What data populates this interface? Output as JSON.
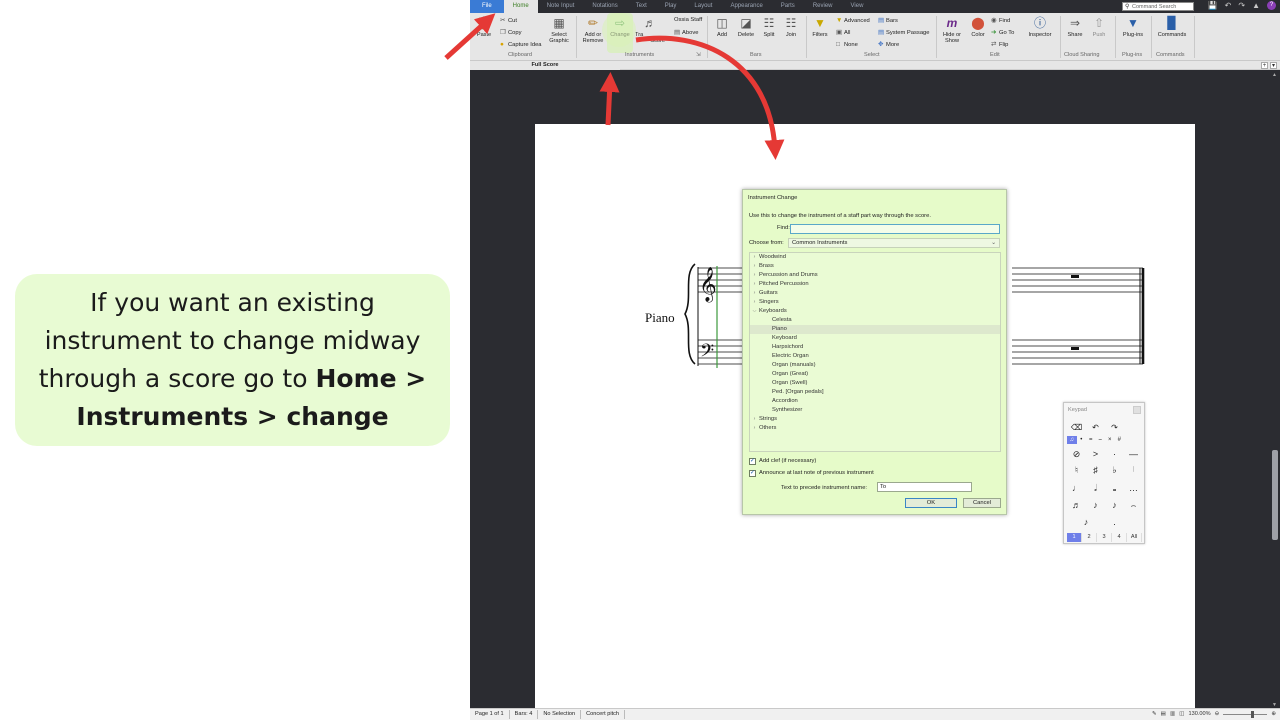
{
  "callout": {
    "line1": "If you want an existing",
    "line2": "instrument to change midway",
    "line3": "through a score go to ",
    "bold1": "Home >",
    "bold2": "Instruments > change"
  },
  "menu": {
    "tabs": [
      "File",
      "Home",
      "Note Input",
      "Notations",
      "Text",
      "Play",
      "Layout",
      "Appearance",
      "Parts",
      "Review",
      "View"
    ],
    "command_search_placeholder": "Command Search"
  },
  "ribbon": {
    "clipboard": {
      "paste": "Paste",
      "cut": "Cut",
      "copy": "Copy",
      "capture_idea": "Capture Idea",
      "select_graphic": "Select Graphic",
      "label": "Clipboard"
    },
    "instruments": {
      "add_or_remove": "Add or Remove",
      "change": "Change",
      "transpose": "Tra",
      "score": "Score",
      "ossia_staff": "Ossia Staff",
      "above": "Above",
      "label": "Instruments"
    },
    "bars": {
      "add": "Add",
      "delete": "Delete",
      "split": "Split",
      "join": "Join",
      "label": "Bars"
    },
    "select": {
      "filters": "Filters",
      "advanced": "Advanced",
      "all": "All",
      "none": "None",
      "bars": "Bars",
      "system_passage": "System Passage",
      "more": "More",
      "label": "Select"
    },
    "edit": {
      "hide_or_show": "Hide or Show",
      "color": "Color",
      "find": "Find",
      "go_to": "Go To",
      "flip": "Flip",
      "inspector": "Inspector",
      "label": "Edit"
    },
    "cloud": {
      "share": "Share",
      "push": "Push",
      "label": "Cloud Sharing"
    },
    "plugins": {
      "plugins": "Plug-ins",
      "label": "Plug-ins"
    },
    "commands": {
      "commands": "Commands",
      "label": "Commands"
    }
  },
  "score_tab": "Full Score",
  "score": {
    "instrument": "Piano"
  },
  "dialog": {
    "title": "Instrument Change",
    "description": "Use this to change the instrument of a staff part way through the score.",
    "find_label": "Find:",
    "find_value": "",
    "choose_from_label": "Choose from:",
    "choose_from_value": "Common Instruments",
    "tree": [
      {
        "label": "Woodwind",
        "expanded": false,
        "child": false,
        "selected": false
      },
      {
        "label": "Brass",
        "expanded": false,
        "child": false,
        "selected": false
      },
      {
        "label": "Percussion and Drums",
        "expanded": false,
        "child": false,
        "selected": false
      },
      {
        "label": "Pitched Percussion",
        "expanded": false,
        "child": false,
        "selected": false
      },
      {
        "label": "Guitars",
        "expanded": false,
        "child": false,
        "selected": false
      },
      {
        "label": "Singers",
        "expanded": false,
        "child": false,
        "selected": false
      },
      {
        "label": "Keyboards",
        "expanded": true,
        "child": false,
        "selected": false
      },
      {
        "label": "Celesta",
        "child": true,
        "selected": false
      },
      {
        "label": "Piano",
        "child": true,
        "selected": true
      },
      {
        "label": "Keyboard",
        "child": true,
        "selected": false
      },
      {
        "label": "Harpsichord",
        "child": true,
        "selected": false
      },
      {
        "label": "Electric Organ",
        "child": true,
        "selected": false
      },
      {
        "label": "Organ (manuals)",
        "child": true,
        "selected": false
      },
      {
        "label": "Organ (Great)",
        "child": true,
        "selected": false
      },
      {
        "label": "Organ (Swell)",
        "child": true,
        "selected": false
      },
      {
        "label": "Ped. [Organ pedals]",
        "child": true,
        "selected": false
      },
      {
        "label": "Accordion",
        "child": true,
        "selected": false
      },
      {
        "label": "Synthesizer",
        "child": true,
        "selected": false
      },
      {
        "label": "Strings",
        "expanded": false,
        "child": false,
        "selected": false
      },
      {
        "label": "Others",
        "expanded": false,
        "child": false,
        "selected": false
      }
    ],
    "add_clef_label": "Add clef (if necessary)",
    "add_clef_checked": true,
    "announce_label": "Announce at last note of previous instrument",
    "announce_checked": true,
    "precede_label": "Text to precede instrument name:",
    "precede_value": "To",
    "ok": "OK",
    "cancel": "Cancel"
  },
  "keypad": {
    "title": "Keypad",
    "tabs": [
      "1",
      "2",
      "3",
      "4",
      "All"
    ],
    "active_tab": "1"
  },
  "status_bar": {
    "page": "Page 1 of 1",
    "bars": "Bars: 4",
    "selection": "No Selection",
    "pitch": "Concert pitch",
    "zoom": "130.00%"
  },
  "colors": {
    "accent_file": "#3a7bd5",
    "highlight_green": "#e6fbc9",
    "callout_bg": "#e8fbd3",
    "arrow_red": "#e53935",
    "keypad_active": "#6f7fe9"
  }
}
